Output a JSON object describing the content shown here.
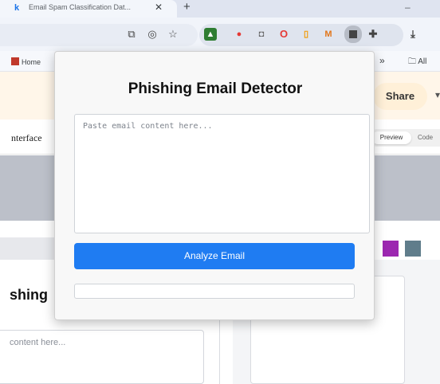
{
  "browser": {
    "tab": {
      "title": "Email Spam Classification Dat...",
      "favicon": "k-icon",
      "close": "✕"
    },
    "new_tab": "+",
    "minimize": "–",
    "toolbar": {
      "icons": [
        "cast-icon",
        "hide-eye-icon",
        "star-icon",
        "android-icon",
        "color-picker-icon",
        "camera-icon",
        "opera-icon",
        "extension-orange-icon",
        "metamask-icon",
        "active-extension-icon",
        "puzzle-icon",
        "download-icon",
        "menu-icon"
      ]
    },
    "bookmarks": {
      "home": "Home",
      "more": "»",
      "all": "All"
    }
  },
  "page": {
    "share_label": "Share",
    "interface_label": "nterface",
    "preview_tab": "Preview",
    "code_tab": "Code",
    "heading_partial": "shing",
    "textarea_placeholder_partial": "content here...",
    "swatch_colors": [
      "#9c27b0",
      "#607d8b"
    ]
  },
  "popup": {
    "title": "Phishing Email Detector",
    "email_placeholder": "Paste email content here...",
    "email_value": "",
    "analyze_label": "Analyze Email",
    "result_text": "",
    "accent_color": "#1f7cf2"
  }
}
